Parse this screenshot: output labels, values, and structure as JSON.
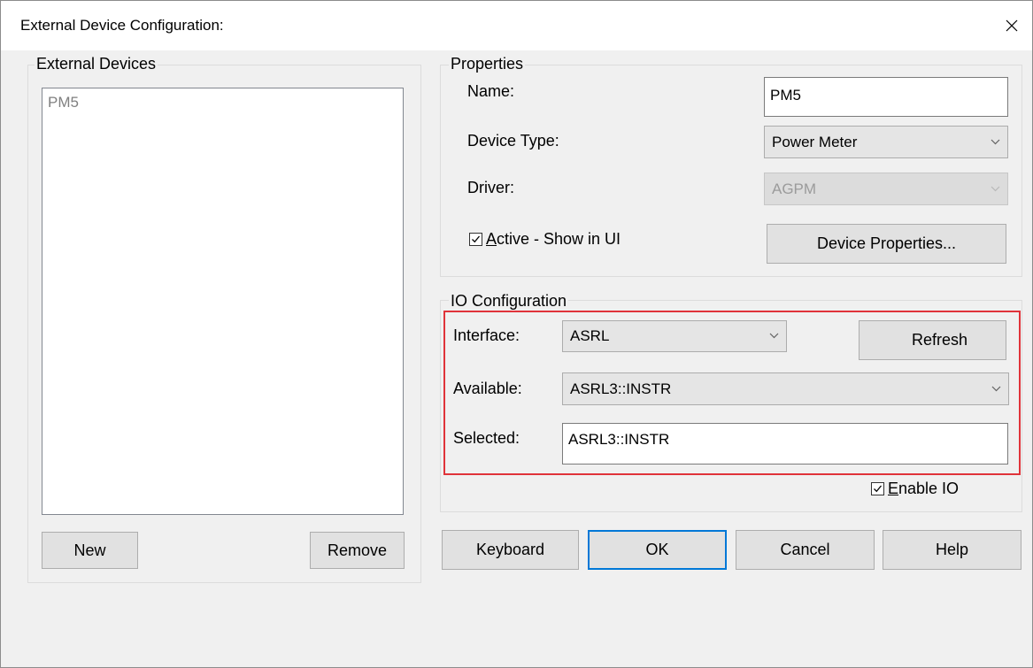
{
  "window": {
    "title": "External Device Configuration:",
    "close_glyph": "✕"
  },
  "devices": {
    "legend": "External Devices",
    "items": [
      "PM5"
    ],
    "new_label": "New",
    "remove_label": "Remove"
  },
  "properties": {
    "legend": "Properties",
    "name_label": "Name:",
    "name_value": "PM5",
    "device_type_label": "Device Type:",
    "device_type_value": "Power Meter",
    "driver_label": "Driver:",
    "driver_value": "AGPM",
    "active_label_u": "A",
    "active_label_rest": "ctive - Show in UI",
    "active_checked": true,
    "device_properties_label": "Device Properties..."
  },
  "io": {
    "legend": "IO Configuration",
    "interface_label": "Interface:",
    "interface_value": "ASRL",
    "refresh_label": "Refresh",
    "available_label": "Available:",
    "available_value": "ASRL3::INSTR",
    "selected_label": "Selected:",
    "selected_value": "ASRL3::INSTR",
    "enable_label_u": "E",
    "enable_label_rest": "nable IO",
    "enable_checked": true,
    "highlight_color": "#e0333a"
  },
  "footer": {
    "keyboard_label": "Keyboard",
    "ok_label": "OK",
    "cancel_label": "Cancel",
    "help_label": "Help"
  },
  "colors": {
    "accent": "#0078d7",
    "window_bg": "#f0f0f0",
    "disabled_text": "#9b9b9b"
  }
}
